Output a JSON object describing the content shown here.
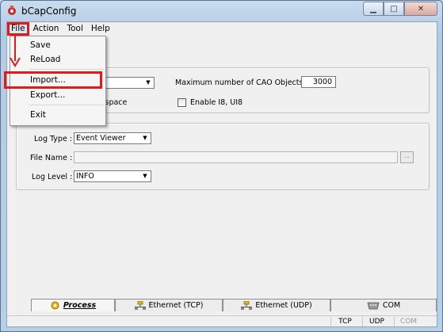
{
  "window": {
    "title": "bCapConfig",
    "controls": {
      "minimize": "▁",
      "maximize": "□",
      "close": "✕"
    }
  },
  "menubar": {
    "items": [
      "File",
      "Action",
      "Tool",
      "Help"
    ]
  },
  "file_menu": {
    "items": [
      "Save",
      "ReLoad",
      "Import...",
      "Export...",
      "Exit"
    ],
    "highlighted": "Import..."
  },
  "process_group": {
    "max_cao_label": "Maximum number of CAO Objects :",
    "max_cao_value": "3000",
    "workspace_partial": "kspace",
    "enable_label": "Enable I8, UI8"
  },
  "log_group": {
    "log_type_label": "Log Type :",
    "log_type_value": "Event Viewer",
    "file_name_label": "File Name :",
    "file_name_value": "",
    "browse_label": "...",
    "log_level_label": "Log Level :",
    "log_level_value": "INFO"
  },
  "tabs": [
    {
      "label": "Process",
      "icon": "gear-icon",
      "active": true
    },
    {
      "label": "Ethernet (TCP)",
      "icon": "network-icon",
      "active": false
    },
    {
      "label": "Ethernet (UDP)",
      "icon": "network-icon",
      "active": false
    },
    {
      "label": "COM",
      "icon": "serial-port-icon",
      "active": false
    }
  ],
  "statusbar": {
    "tcp": "TCP",
    "udp": "UDP",
    "com": "COM"
  },
  "colors": {
    "annotation_red": "#e11a1a",
    "disabled_text": "#9a9a9a"
  }
}
